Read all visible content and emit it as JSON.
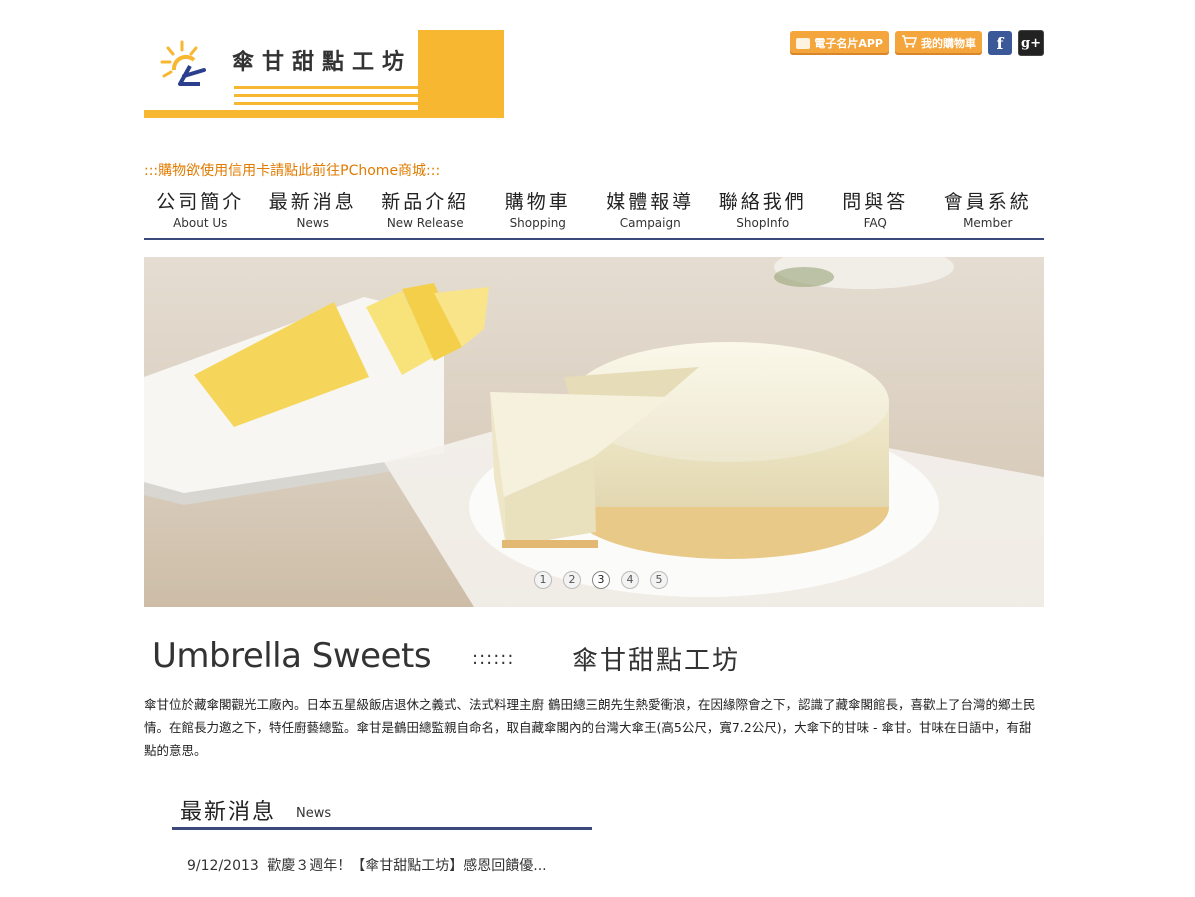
{
  "brand": {
    "name": "傘甘甜點工坊"
  },
  "top_links": {
    "app_label": "電子名片APP",
    "cart_label": "我的購物車",
    "facebook_label": "f",
    "google_label": "g+"
  },
  "notice": ":::購物欲使用信用卡請點此前往PChome商城:::",
  "nav": [
    {
      "zh": "公司簡介",
      "en": "About Us"
    },
    {
      "zh": "最新消息",
      "en": "News"
    },
    {
      "zh": "新品介紹",
      "en": "New Release"
    },
    {
      "zh": "購物車",
      "en": "Shopping"
    },
    {
      "zh": "媒體報導",
      "en": "Campaign"
    },
    {
      "zh": "聯絡我們",
      "en": "ShopInfo"
    },
    {
      "zh": "問與答",
      "en": "FAQ"
    },
    {
      "zh": "會員系統",
      "en": "Member"
    }
  ],
  "slider": {
    "pages": [
      "1",
      "2",
      "3",
      "4",
      "5"
    ],
    "active_page": "3"
  },
  "intro": {
    "title_en": "Umbrella Sweets",
    "separator": "::::::",
    "title_zh": "傘甘甜點工坊",
    "text": "傘甘位於藏傘閣觀光工廠內。日本五星級飯店退休之義式、法式料理主廚 鶴田總三朗先生熱愛衝浪，在因緣際會之下，認識了藏傘閣館長，喜歡上了台灣的鄉土民情。在館長力邀之下，特任廚藝總監。傘甘是鶴田總監親自命名，取自藏傘閣內的台灣大傘王(高5公尺，寬7.2公尺)，大傘下的甘味 - 傘甘。甘味在日語中，有甜點的意思。"
  },
  "news": {
    "title_zh": "最新消息",
    "title_en": "News",
    "items": [
      {
        "date": "9/12/2013",
        "title": "歡慶３週年！【傘甘甜點工坊】感恩回饋優..."
      }
    ]
  },
  "colors": {
    "accent": "#f7b731",
    "nav_line": "#3b4a7a",
    "notice": "#e07b00"
  }
}
